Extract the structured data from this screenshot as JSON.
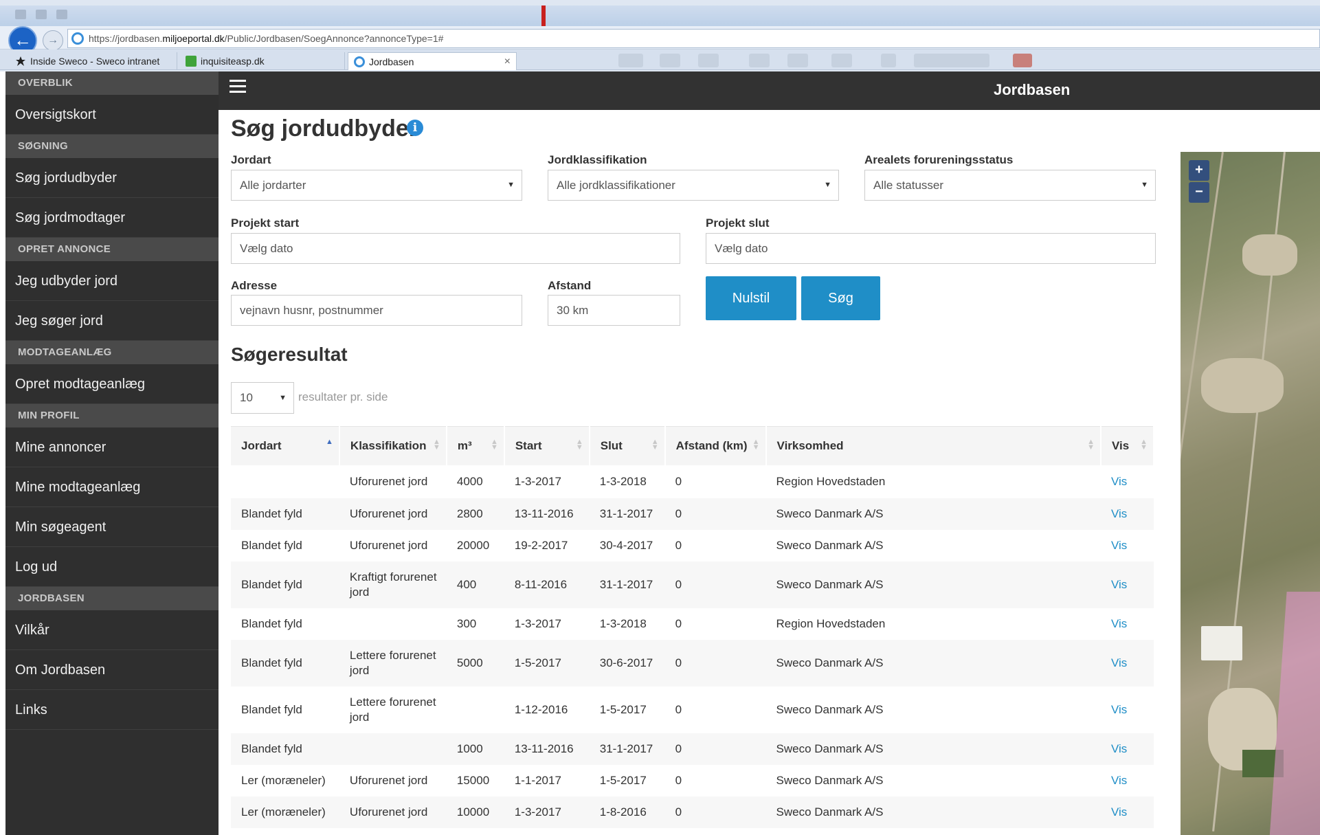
{
  "browser": {
    "url_prefix": "https://jordbasen.",
    "url_domain": "miljoeportal.dk",
    "url_path": "/Public/Jordbasen/SoegAnnonce?annonceType=1#",
    "tabs": [
      {
        "label": "Inside Sweco - Sweco intranet"
      },
      {
        "label": "inquisiteasp.dk"
      },
      {
        "label": "Jordbasen"
      }
    ],
    "back_glyph": "←",
    "forward_glyph": "→",
    "close_glyph": "×"
  },
  "app": {
    "title": "Jordbasen"
  },
  "sidebar": {
    "sections": [
      {
        "heading": "OVERBLIK",
        "items": [
          "Oversigtskort"
        ]
      },
      {
        "heading": "SØGNING",
        "items": [
          "Søg jordudbyder",
          "Søg jordmodtager"
        ]
      },
      {
        "heading": "OPRET ANNONCE",
        "items": [
          "Jeg udbyder jord",
          "Jeg søger jord"
        ]
      },
      {
        "heading": "MODTAGEANLÆG",
        "items": [
          "Opret modtageanlæg"
        ]
      },
      {
        "heading": "MIN PROFIL",
        "items": [
          "Mine annoncer",
          "Mine modtageanlæg",
          "Min søgeagent",
          "Log ud"
        ]
      },
      {
        "heading": "JORDBASEN",
        "items": [
          "Vilkår",
          "Om Jordbasen",
          "Links"
        ]
      }
    ]
  },
  "search": {
    "title": "Søg jordudbyder",
    "info_glyph": "i",
    "jordart": {
      "label": "Jordart",
      "value": "Alle jordarter"
    },
    "jordklassifikation": {
      "label": "Jordklassifikation",
      "value": "Alle jordklassifikationer"
    },
    "forureningsstatus": {
      "label": "Arealets forureningsstatus",
      "value": "Alle statusser"
    },
    "projekt_start": {
      "label": "Projekt start",
      "placeholder": "Vælg dato"
    },
    "projekt_slut": {
      "label": "Projekt slut",
      "placeholder": "Vælg dato"
    },
    "adresse": {
      "label": "Adresse",
      "placeholder": "vejnavn husnr, postnummer"
    },
    "afstand": {
      "label": "Afstand",
      "value": "30 km"
    },
    "reset_label": "Nulstil",
    "search_label": "Søg"
  },
  "results": {
    "title": "Søgeresultat",
    "per_page_value": "10",
    "per_page_label": "resultater pr. side",
    "columns": [
      "Jordart",
      "Klassifikation",
      "m³",
      "Start",
      "Slut",
      "Afstand (km)",
      "Virksomhed",
      "Vis"
    ],
    "rows": [
      {
        "jordart": "",
        "klassifikation": "Uforurenet jord",
        "m3": "4000",
        "start": "1-3-2017",
        "slut": "1-3-2018",
        "afstand": "0",
        "virksomhed": "Region Hovedstaden",
        "vis": "Vis"
      },
      {
        "jordart": "Blandet fyld",
        "klassifikation": "Uforurenet jord",
        "m3": "2800",
        "start": "13-11-2016",
        "slut": "31-1-2017",
        "afstand": "0",
        "virksomhed": "Sweco Danmark A/S",
        "vis": "Vis"
      },
      {
        "jordart": "Blandet fyld",
        "klassifikation": "Uforurenet jord",
        "m3": "20000",
        "start": "19-2-2017",
        "slut": "30-4-2017",
        "afstand": "0",
        "virksomhed": "Sweco Danmark A/S",
        "vis": "Vis"
      },
      {
        "jordart": "Blandet fyld",
        "klassifikation": "Kraftigt forurenet jord",
        "m3": "400",
        "start": "8-11-2016",
        "slut": "31-1-2017",
        "afstand": "0",
        "virksomhed": "Sweco Danmark A/S",
        "vis": "Vis"
      },
      {
        "jordart": "Blandet fyld",
        "klassifikation": "",
        "m3": "300",
        "start": "1-3-2017",
        "slut": "1-3-2018",
        "afstand": "0",
        "virksomhed": "Region Hovedstaden",
        "vis": "Vis"
      },
      {
        "jordart": "Blandet fyld",
        "klassifikation": "Lettere forurenet jord",
        "m3": "5000",
        "start": "1-5-2017",
        "slut": "30-6-2017",
        "afstand": "0",
        "virksomhed": "Sweco Danmark A/S",
        "vis": "Vis"
      },
      {
        "jordart": "Blandet fyld",
        "klassifikation": "Lettere forurenet jord",
        "m3": "",
        "start": "1-12-2016",
        "slut": "1-5-2017",
        "afstand": "0",
        "virksomhed": "Sweco Danmark A/S",
        "vis": "Vis"
      },
      {
        "jordart": "Blandet fyld",
        "klassifikation": "",
        "m3": "1000",
        "start": "13-11-2016",
        "slut": "31-1-2017",
        "afstand": "0",
        "virksomhed": "Sweco Danmark A/S",
        "vis": "Vis"
      },
      {
        "jordart": "Ler (moræneler)",
        "klassifikation": "Uforurenet jord",
        "m3": "15000",
        "start": "1-1-2017",
        "slut": "1-5-2017",
        "afstand": "0",
        "virksomhed": "Sweco Danmark A/S",
        "vis": "Vis"
      },
      {
        "jordart": "Ler (moræneler)",
        "klassifikation": "Uforurenet jord",
        "m3": "10000",
        "start": "1-3-2017",
        "slut": "1-8-2016",
        "afstand": "0",
        "virksomhed": "Sweco Danmark A/S",
        "vis": "Vis"
      }
    ]
  },
  "map": {
    "zoom_in": "+",
    "zoom_out": "−"
  }
}
